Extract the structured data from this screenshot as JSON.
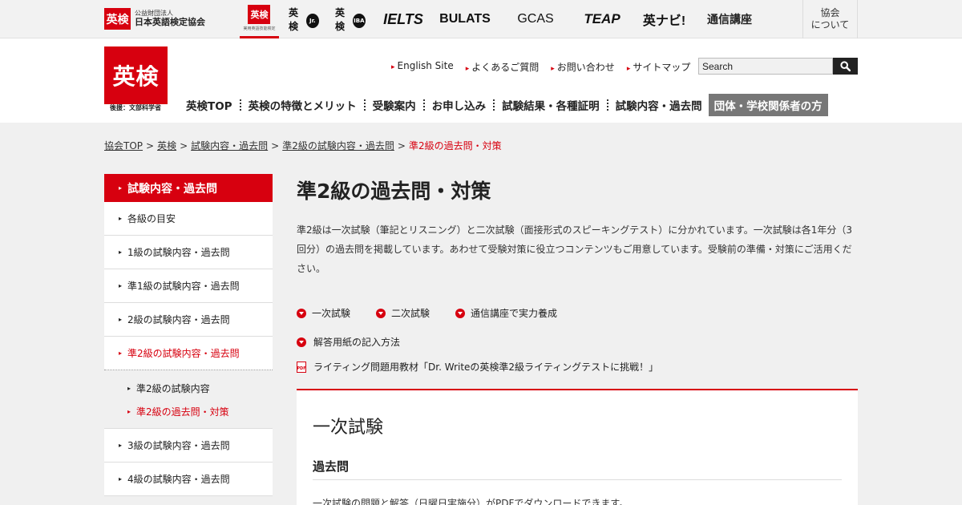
{
  "topbar": {
    "org": {
      "mark": "英検",
      "line1": "公益財団法人",
      "line2": "日本英語検定協会"
    },
    "brands": {
      "eiken": {
        "mark": "英検",
        "caption": "実用英語技能検定"
      },
      "jr": {
        "word": "英検",
        "badge": "Jr."
      },
      "iba": {
        "word": "英検",
        "badge": "IBA"
      },
      "ielts": "IELTS",
      "bulats": "BULATS",
      "gcas": "GCAS",
      "teap": "TEAP",
      "enavi": "英ナビ!",
      "tsushin": "通信講座"
    },
    "about": [
      "協会",
      "について"
    ]
  },
  "header": {
    "logo": "英検",
    "logo_caption": "後援：文部科学省",
    "util_nav": [
      "English Site",
      "よくあるご質問",
      "お問い合わせ",
      "サイトマップ"
    ],
    "search": {
      "placeholder": "Search"
    },
    "global_nav": [
      "英検TOP",
      "英検の特徴とメリット",
      "受験案内",
      "お申し込み",
      "試験結果・各種証明",
      "試験内容・過去問"
    ],
    "global_nav_special": "団体・学校関係者の方"
  },
  "breadcrumb": {
    "items": [
      "協会TOP",
      "英検",
      "試験内容・過去問",
      "準2級の試験内容・過去問"
    ],
    "current": "準2級の過去問・対策"
  },
  "sidebar": {
    "heading": "試験内容・過去問",
    "items": [
      "各級の目安",
      "1級の試験内容・過去問",
      "準1級の試験内容・過去問",
      "2級の試験内容・過去問",
      "準2級の試験内容・過去問"
    ],
    "sub_items": [
      "準2級の試験内容",
      "準2級の過去問・対策"
    ],
    "items_after": [
      "3級の試験内容・過去問",
      "4級の試験内容・過去問"
    ]
  },
  "main": {
    "title": "準2級の過去問・対策",
    "intro": "準2級は一次試験（筆記とリスニング）と二次試験（面接形式のスピーキングテスト）に分かれています。一次試験は各1年分（3回分）の過去問を掲載しています。あわせて受験対策に役立つコンテンツもご用意しています。受験前の準備・対策にご活用ください。",
    "anchors": [
      "一次試験",
      "二次試験",
      "通信講座で実力養成"
    ],
    "answer_sheet_link": "解答用紙の記入方法",
    "pdf_link": "ライティング問題用教材「Dr. Writeの英検準2級ライティングテストに挑戦！」",
    "pdf_icon_label": "PDF",
    "section": {
      "title": "一次試験",
      "subtitle": "過去問",
      "text": "一次試験の問題と解答（日曜日実施分）がPDFでダウンロードできます。"
    }
  },
  "colors": {
    "accent": "#d7000f",
    "nav_special_bg": "#777777"
  }
}
